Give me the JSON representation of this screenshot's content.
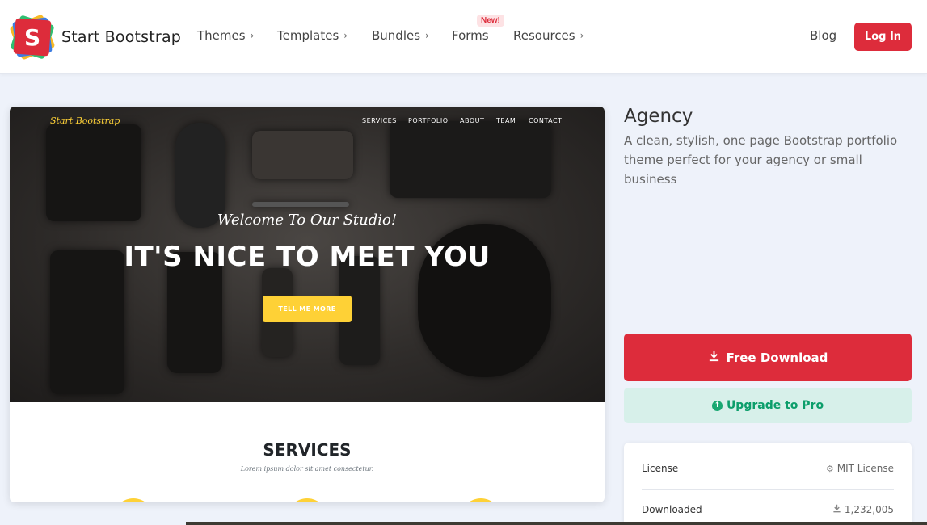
{
  "brand": {
    "name": "Start Bootstrap",
    "logo_letter": "S"
  },
  "nav": {
    "items": [
      {
        "label": "Themes",
        "chevron": "›"
      },
      {
        "label": "Templates",
        "chevron": "›"
      },
      {
        "label": "Bundles",
        "chevron": "›"
      },
      {
        "label": "Forms",
        "chevron": ""
      },
      {
        "label": "Resources",
        "chevron": "›"
      }
    ],
    "forms_badge": "New!",
    "blog": "Blog",
    "login": "Log In"
  },
  "preview": {
    "brand": "Start Bootstrap",
    "nav": [
      "SERVICES",
      "PORTFOLIO",
      "ABOUT",
      "TEAM",
      "CONTACT"
    ],
    "subheading": "Welcome To Our Studio!",
    "heading": "IT'S NICE TO MEET YOU",
    "cta": "TELL ME MORE",
    "services_title": "SERVICES",
    "services_subtitle": "Lorem ipsum dolor sit amet consectetur."
  },
  "theme": {
    "title": "Agency",
    "description": "A clean, stylish, one page Bootstrap portfolio theme perfect for your agency or small business",
    "download_label": "Free Download",
    "upgrade_label": "Upgrade to Pro"
  },
  "info": {
    "license_label": "License",
    "license_value": "MIT License",
    "downloaded_label": "Downloaded",
    "downloaded_value": "1,232,005"
  },
  "colors": {
    "brand_red": "#dd2c3b",
    "accent_yellow": "#fed136",
    "pro_green": "#0c9e6b",
    "page_bg": "#eef2fa"
  },
  "icons": [
    "logo-icon",
    "chevron-right-icon",
    "download-icon",
    "arrow-up-circle-icon",
    "license-icon"
  ]
}
